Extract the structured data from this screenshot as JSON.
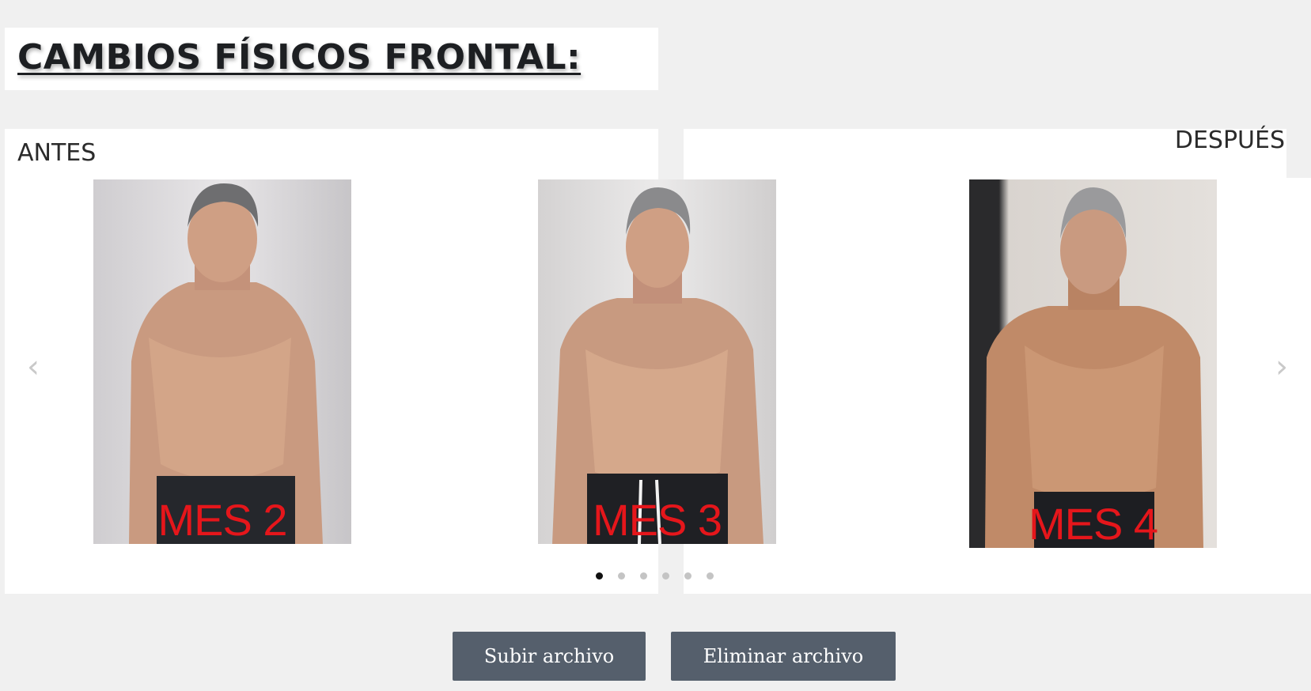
{
  "header": {
    "title": "CAMBIOS FÍSICOS FRONTAL:"
  },
  "labels": {
    "before": "ANTES",
    "after": "DESPUÉS"
  },
  "carousel": {
    "slides": [
      {
        "caption": "MES 2"
      },
      {
        "caption": "MES 3"
      },
      {
        "caption": "MES 4"
      }
    ],
    "prev_icon": "‹",
    "next_icon": "›",
    "dot_count": 6,
    "active_dot": 0
  },
  "buttons": {
    "upload": "Subir archivo",
    "delete": "Eliminar archivo"
  },
  "colors": {
    "caption": "#e5161b",
    "button": "#555f6c"
  }
}
